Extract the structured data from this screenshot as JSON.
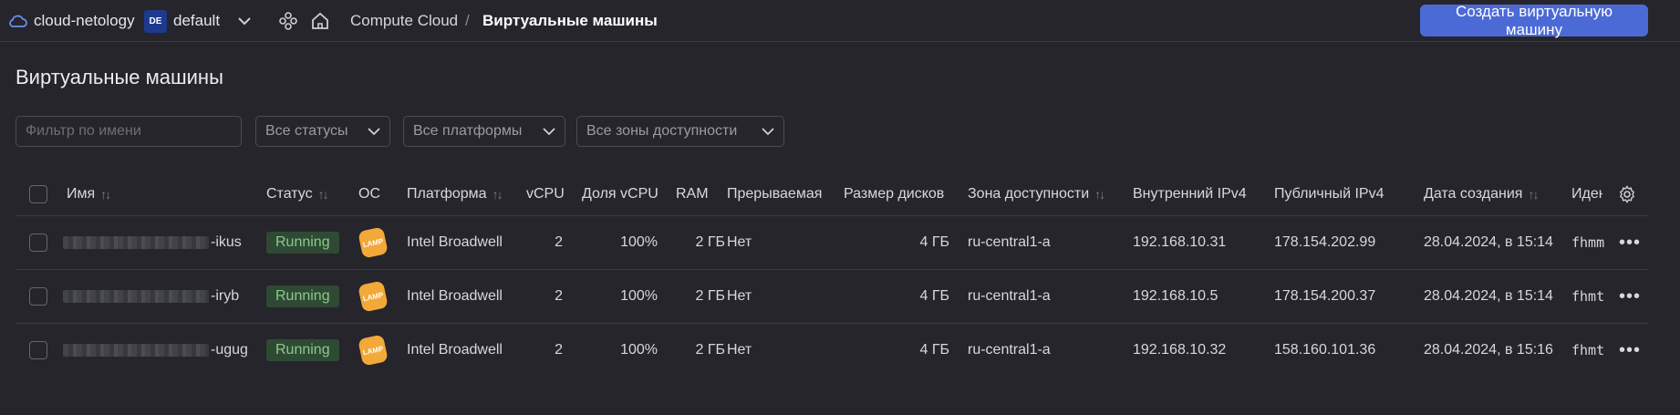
{
  "header": {
    "cloud_name": "cloud-netology",
    "folder_badge": "DE",
    "folder_name": "default",
    "breadcrumb_service": "Compute Cloud",
    "breadcrumb_sep": "/",
    "breadcrumb_current": "Виртуальные машины",
    "create_button": "Создать виртуальную машину"
  },
  "page": {
    "title": "Виртуальные машины"
  },
  "filters": {
    "name_placeholder": "Фильтр по имени",
    "status": "Все статусы",
    "platform": "Все платформы",
    "zone": "Все зоны доступности"
  },
  "table": {
    "columns": {
      "name": "Имя",
      "status": "Статус",
      "os": "ОС",
      "platform": "Платформа",
      "vcpu": "vCPU",
      "vcpu_share": "Доля vCPU",
      "ram": "RAM",
      "preemptible": "Прерываемая",
      "disk_size": "Размер дисков",
      "zone": "Зона доступности",
      "internal_ip": "Внутренний IPv4",
      "public_ip": "Публичный IPv4",
      "created": "Дата создания",
      "id": "Иден"
    },
    "rows": [
      {
        "name_suffix": "-ikus",
        "status": "Running",
        "os_badge": "LAMP",
        "platform": "Intel Broadwell",
        "vcpu": "2",
        "vcpu_share": "100%",
        "ram": "2 ГБ",
        "preemptible": "Нет",
        "disk_size": "4 ГБ",
        "zone": "ru-central1-a",
        "internal_ip": "192.168.10.31",
        "public_ip": "178.154.202.99",
        "created": "28.04.2024, в 15:14",
        "id": "fhmm"
      },
      {
        "name_suffix": "-iryb",
        "status": "Running",
        "os_badge": "LAMP",
        "platform": "Intel Broadwell",
        "vcpu": "2",
        "vcpu_share": "100%",
        "ram": "2 ГБ",
        "preemptible": "Нет",
        "disk_size": "4 ГБ",
        "zone": "ru-central1-a",
        "internal_ip": "192.168.10.5",
        "public_ip": "178.154.200.37",
        "created": "28.04.2024, в 15:14",
        "id": "fhmt"
      },
      {
        "name_suffix": "-ugug",
        "status": "Running",
        "os_badge": "LAMP",
        "platform": "Intel Broadwell",
        "vcpu": "2",
        "vcpu_share": "100%",
        "ram": "2 ГБ",
        "preemptible": "Нет",
        "disk_size": "4 ГБ",
        "zone": "ru-central1-a",
        "internal_ip": "192.168.10.32",
        "public_ip": "158.160.101.36",
        "created": "28.04.2024, в 15:16",
        "id": "fhmt"
      }
    ]
  },
  "icons": {
    "cloud": "cloud-icon",
    "folder_chevron": "chevron-down-icon",
    "services": "services-icon",
    "home": "home-icon",
    "sort": "sort-icon",
    "settings": "gear-icon",
    "row_menu": "more-icon"
  },
  "colors": {
    "accent": "#4c6ad6",
    "status_running_bg": "#2f4a34",
    "status_running_text": "#89c98a",
    "os_badge": "#f2a93a",
    "background": "#25252b"
  }
}
